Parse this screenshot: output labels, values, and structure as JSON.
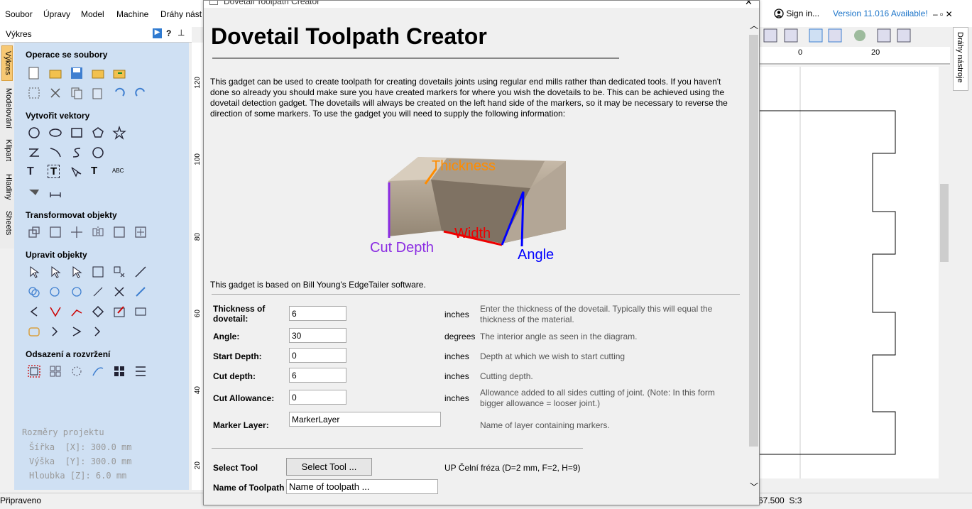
{
  "menubar": {
    "items": [
      "Soubor",
      "Úpravy",
      "Model",
      "Machine",
      "Dráhy nást"
    ],
    "sign_in": "Sign in...",
    "version": "Version 11.016 Available!"
  },
  "left_panel": {
    "header": "Výkres",
    "tabs": [
      "Výkres",
      "Modelování",
      "Klipart",
      "Hladiny",
      "Sheets"
    ],
    "sections": {
      "file_ops": "Operace se soubory",
      "create_vectors": "Vytvořit vektory",
      "transform": "Transformovat objekty",
      "edit": "Upravit objekty",
      "offset": "Odsazení a rozvržení"
    },
    "project": {
      "title": "Rozměry projektu",
      "width": "Šířka  [X]: 300.0 mm",
      "height": "Výška  [Y]: 300.0 mm",
      "depth": "Hloubka [Z]: 6.0 mm"
    }
  },
  "ruler": {
    "labels": [
      "120",
      "100",
      "80",
      "60",
      "40",
      "20"
    ]
  },
  "top_ruler": {
    "labels": [
      "0",
      "20"
    ]
  },
  "status": {
    "left": "Připraveno",
    "right": "67.500  S:3"
  },
  "right_tab": "Dráhy nástroje",
  "dialog": {
    "title": "Dovetail Toolpath Creator",
    "heading": "Dovetail Toolpath Creator",
    "intro": "This gadget can be used to create toolpath for creating dovetails joints using regular end mills rather than dedicated tools. If you haven't done so already you should make sure you have created markers for where you wish the dovetails to be. This can be achieved using the dovetail detection gadget. The dovetails will always be created on the left hand side of the markers, so it may be necessary to reverse the direction of some markers. To use the gadget you will need to supply the following information:",
    "diagram": {
      "thickness": "Thickness",
      "width": "Width",
      "cut_depth": "Cut Depth",
      "angle": "Angle"
    },
    "credit": "This gadget is based on Bill Young's EdgeTailer software.",
    "fields": {
      "thickness": {
        "label": "Thickness of dovetail:",
        "value": "6",
        "unit": "inches",
        "desc": "Enter the thickness of the dovetail. Typically this will equal the thickness of the material."
      },
      "angle": {
        "label": "Angle:",
        "value": "30",
        "unit": "degrees",
        "desc": "The interior angle as seen in the diagram."
      },
      "start_depth": {
        "label": "Start Depth:",
        "value": "0",
        "unit": "inches",
        "desc": "Depth at which we wish to start cutting"
      },
      "cut_depth": {
        "label": "Cut depth:",
        "value": "6",
        "unit": "inches",
        "desc": "Cutting depth."
      },
      "allowance": {
        "label": "Cut Allowance:",
        "value": "0",
        "unit": "inches",
        "desc": "Allowance added to all sides cutting of joint. (Note: In this form bigger allowance = looser joint.)"
      },
      "marker_layer": {
        "label": "Marker Layer:",
        "value": "MarkerLayer",
        "desc": "Name of layer containing markers."
      }
    },
    "select_tool": {
      "label": "Select Tool",
      "button": "Select Tool ...",
      "tool": "UP Čelní fréza (D=2 mm, F=2, H=9)"
    },
    "toolpath_name": {
      "label": "Name of Toolpath",
      "value": "Name of toolpath ..."
    }
  }
}
